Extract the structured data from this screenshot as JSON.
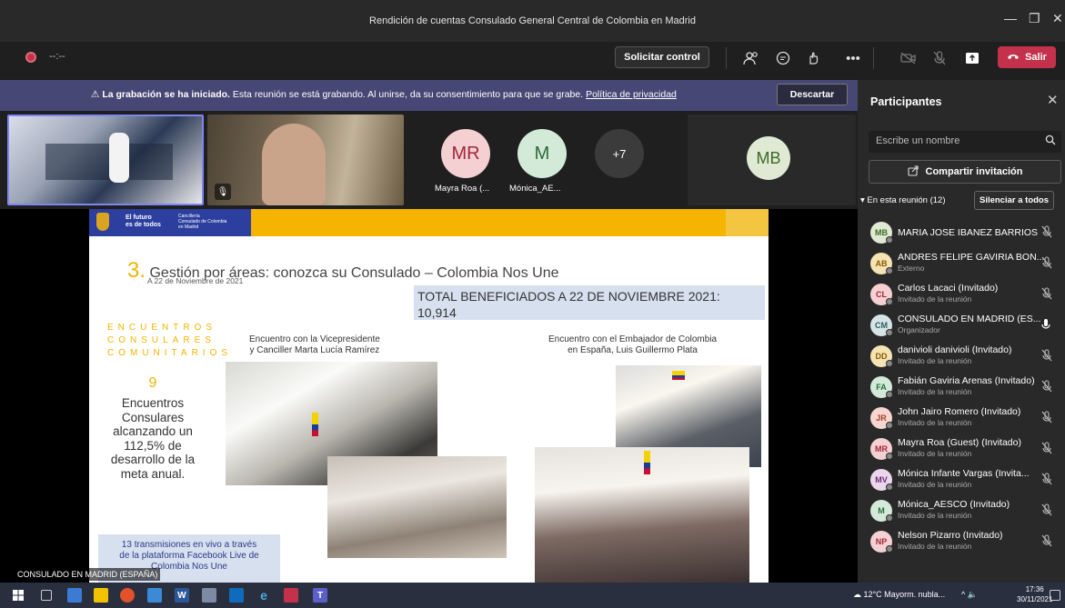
{
  "window": {
    "title": "Rendición de cuentas Consulado General Central de Colombia en Madrid"
  },
  "toolbar": {
    "timer": "--:--",
    "request_control": "Solicitar control",
    "leave": "Salir"
  },
  "banner": {
    "bold": "La grabación se ha iniciado.",
    "text": "Esta reunión se está grabando. Al unirse, da su consentimiento para que se grabe.",
    "link": "Política de privacidad",
    "dismiss": "Descartar"
  },
  "tiles": {
    "avatar1": {
      "initials": "MR",
      "name": "Mayra Roa (..."
    },
    "avatar2": {
      "initials": "M",
      "name": "Mónica_AE..."
    },
    "more": "+7",
    "avatar3": {
      "initials": "MB"
    }
  },
  "slide": {
    "logo_line1": "El futuro",
    "logo_line2": "es de todos",
    "logo_small1": "Cancillería",
    "logo_small2": "Consulado de Colombia",
    "logo_small3": "en Madrid",
    "number": "3.",
    "title": "Gestión por áreas: conozca su Consulado – Colombia Nos Une",
    "subtitle": "A 22 de Noviembre de 2021",
    "total_line1": "TOTAL BENEFICIADOS A 22 DE NOVIEMBRE 2021:",
    "total_line2": "10,914",
    "enc1": "ENCUENTROS",
    "enc2": "CONSULARES",
    "enc3": "COMUNITARIOS",
    "count": "9",
    "desc": "Encuentros Consulares alcanzando un 112,5% de desarrollo de la meta anual.",
    "cap1_l1": "Encuentro con la Vicepresidente",
    "cap1_l2": "y Canciller Marta Lucía Ramírez",
    "cap2_l1": "Encuentro con el Embajador de Colombia",
    "cap2_l2": "en España, Luis Guillermo Plata",
    "trans_l1": "13 transmisiones en vivo a través",
    "trans_l2": "de la plataforma Facebook Live de",
    "trans_l3": "Colombia Nos Une"
  },
  "name_tag": "CONSULADO EN MADRID (ESPAÑA)",
  "panel": {
    "title": "Participantes",
    "search_placeholder": "Escribe un nombre",
    "share": "Compartir invitación",
    "in_meeting": "En esta reunión (12)",
    "mute_all": "Silenciar a todos",
    "participants": [
      {
        "initials": "MB",
        "name": "MARIA JOSE IBANEZ BARRIOS",
        "role": "",
        "color": "#dfe9d3",
        "fg": "#3d6b25"
      },
      {
        "initials": "AB",
        "name": "ANDRES FELIPE GAVIRIA BON...",
        "role": "Externo",
        "color": "#f6e3b3",
        "fg": "#8a5b00"
      },
      {
        "initials": "CL",
        "name": "Carlos Lacaci (Invitado)",
        "role": "Invitado de la reunión",
        "color": "#f4d0d3",
        "fg": "#a3283a"
      },
      {
        "initials": "CM",
        "name": "CONSULADO EN MADRID (ES...",
        "role": "Organizador",
        "color": "#d6e4e6",
        "fg": "#2e5c63"
      },
      {
        "initials": "DD",
        "name": "danivioli danivioli (Invitado)",
        "role": "Invitado de la reunión",
        "color": "#f6e3b3",
        "fg": "#8a5b00"
      },
      {
        "initials": "FA",
        "name": "Fabián Gaviria Arenas (Invitado)",
        "role": "Invitado de la reunión",
        "color": "#d4ead9",
        "fg": "#2b6b3a"
      },
      {
        "initials": "JR",
        "name": "John Jairo Romero (Invitado)",
        "role": "Invitado de la reunión",
        "color": "#f6d6cf",
        "fg": "#a3402a"
      },
      {
        "initials": "MR",
        "name": "Mayra Roa (Guest) (Invitado)",
        "role": "Invitado de la reunión",
        "color": "#f4d0d3",
        "fg": "#a3283a"
      },
      {
        "initials": "MV",
        "name": "Mónica Infante Vargas (Invita...",
        "role": "Invitado de la reunión",
        "color": "#ead7ec",
        "fg": "#6c2d78"
      },
      {
        "initials": "M",
        "name": "Mónica_AESCO (Invitado)",
        "role": "Invitado de la reunión",
        "color": "#d4ead9",
        "fg": "#2b6b3a"
      },
      {
        "initials": "NP",
        "name": "Nelson Pizarro (Invitado)",
        "role": "Invitado de la reunión",
        "color": "#f4d0d3",
        "fg": "#a3283a"
      }
    ]
  },
  "taskbar": {
    "weather": "12°C Mayorm. nubla...",
    "time": "17:36",
    "date": "30/11/2021"
  },
  "colors": {
    "accent": "#6264a7",
    "leave_red": "#c4314b",
    "slide_yellow": "#f4b400"
  }
}
